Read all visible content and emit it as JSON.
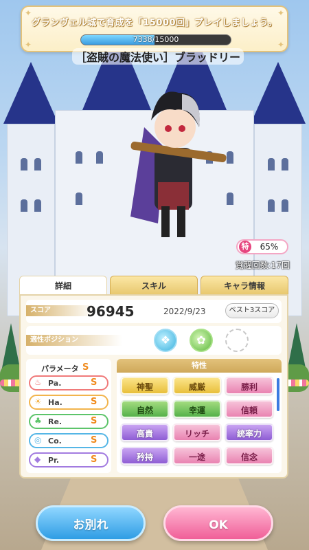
{
  "mission": {
    "text": "グランヴェル城で育成を「15000回」プレイしましょう。",
    "current": 7338,
    "total": 15000,
    "progress_label": "7338/15000"
  },
  "character": {
    "name": "［盗賊の魔法使い］ブラッドリー"
  },
  "rarity": {
    "icon": "特",
    "value": "65%"
  },
  "awaken": "覚醒回数:17回",
  "tabs": [
    "詳細",
    "スキル",
    "キャラ情報"
  ],
  "score": {
    "label": "スコア",
    "value": "96945",
    "date": "2022/9/23",
    "best_button": "ベスト3スコア"
  },
  "position": {
    "label": "適性ポジション",
    "icons": [
      "position-1-icon",
      "position-2-icon",
      "empty-position-slot"
    ]
  },
  "params": {
    "header": "パラメータ",
    "header_grade": "S",
    "items": [
      {
        "label": "Pa.",
        "grade": "S",
        "icon": "flame-icon",
        "color": "#f07a7a"
      },
      {
        "label": "Ha.",
        "grade": "S",
        "icon": "sun-icon",
        "color": "#f2b44c"
      },
      {
        "label": "Re.",
        "grade": "S",
        "icon": "clover-icon",
        "color": "#5cc46a"
      },
      {
        "label": "Co.",
        "grade": "S",
        "icon": "swirl-icon",
        "color": "#55b6e6"
      },
      {
        "label": "Pr.",
        "grade": "S",
        "icon": "gem-icon",
        "color": "#a27be0"
      }
    ]
  },
  "traits": {
    "header": "特性",
    "items": [
      {
        "label": "神聖",
        "color": "yellow"
      },
      {
        "label": "威厳",
        "color": "yellow"
      },
      {
        "label": "勝利",
        "color": "pink"
      },
      {
        "label": "自然",
        "color": "green"
      },
      {
        "label": "幸運",
        "color": "green"
      },
      {
        "label": "信頼",
        "color": "pink"
      },
      {
        "label": "高貴",
        "color": "purple"
      },
      {
        "label": "リッチ",
        "color": "pink"
      },
      {
        "label": "統率力",
        "color": "purple"
      },
      {
        "label": "矜持",
        "color": "purple"
      },
      {
        "label": "一途",
        "color": "pink"
      },
      {
        "label": "信念",
        "color": "pink"
      }
    ]
  },
  "buttons": {
    "part": "お別れ",
    "ok": "OK"
  },
  "colors": {
    "gold": "#e3c27b",
    "blue_button": "#2f9de4",
    "pink_button": "#f05f98"
  }
}
